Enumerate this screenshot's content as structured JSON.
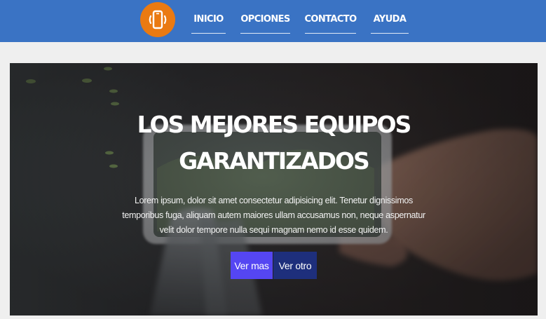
{
  "header": {
    "logo_icon": "phone-vibrate-icon",
    "brand_color": "#3a73c4",
    "logo_color": "#ea7a12",
    "nav": [
      {
        "label": "INICIO"
      },
      {
        "label": "OPCIONES"
      },
      {
        "label": "CONTACTO"
      },
      {
        "label": "AYUDA"
      }
    ]
  },
  "hero": {
    "title_line1": "LOS MEJORES EQUIPOS",
    "title_line2": "GARANTIZADOS",
    "text": "Lorem ipsum, dolor sit amet consectetur adipisicing elit. Tenetur dignissimos temporibus fuga, aliquam autem maiores ullam accusamus non, neque aspernatur velit dolor tempore nulla sequi magnam nemo id esse quidem.",
    "primary_button": "Ver mas",
    "secondary_button": "Ver otro",
    "primary_color": "#5546f2",
    "secondary_color": "#1e2f7c"
  }
}
